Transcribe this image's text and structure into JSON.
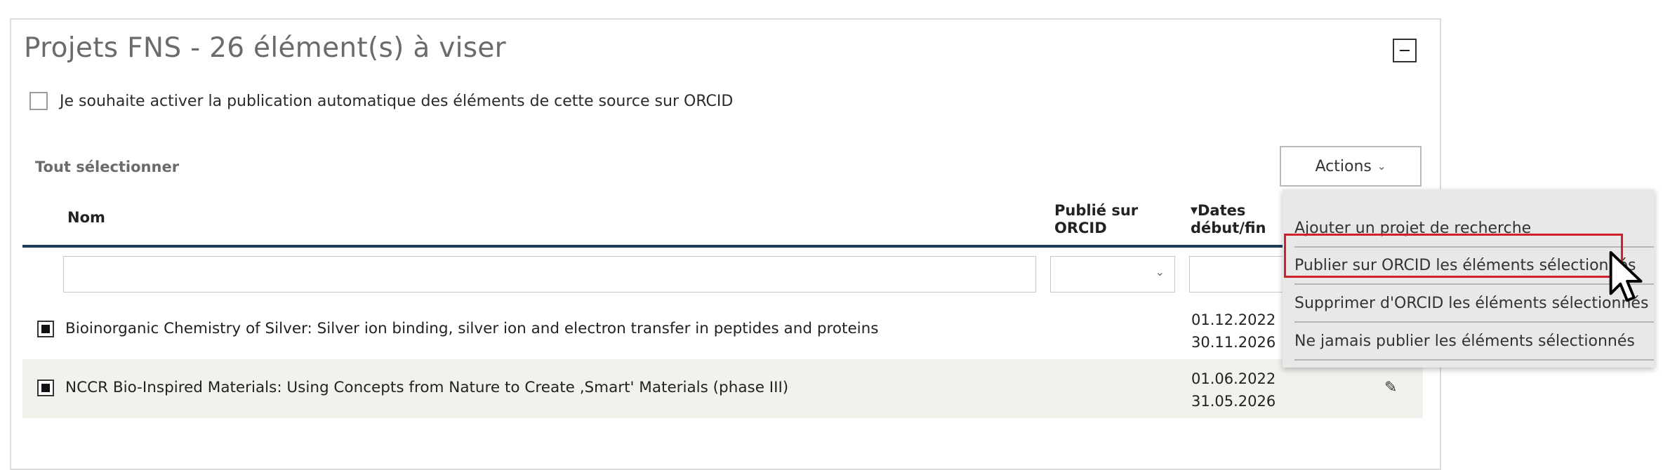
{
  "panel": {
    "title": "Projets FNS - 26 élément(s) à viser",
    "auto_publish_label": "Je souhaite activer la publication automatique des éléments de cette source sur ORCID",
    "select_all_label": "Tout sélectionner",
    "actions_label": "Actions",
    "icons": {
      "collapse": "minus-box-icon",
      "actions_chevron": "chevron-down-icon",
      "sort": "sort-desc-icon",
      "edit": "edit-icon",
      "cursor": "mouse-pointer-icon"
    }
  },
  "table": {
    "columns": {
      "nom": "Nom",
      "published": "Publié sur ORCID",
      "dates": "Dates début/fin"
    },
    "rows": [
      {
        "name": "Bioinorganic Chemistry of Silver: Silver ion binding, silver ion and electron transfer in peptides and proteins",
        "start": "01.12.2022",
        "end": "30.11.2026",
        "checked": true
      },
      {
        "name": "NCCR Bio-Inspired Materials: Using Concepts from Nature to Create ‚Smart' Materials (phase III)",
        "start": "01.06.2022",
        "end": "31.05.2026",
        "checked": true
      }
    ]
  },
  "dropdown": {
    "items": [
      "Ajouter un projet de recherche",
      "Publier sur ORCID les éléments sélectionnés",
      "Supprimer d'ORCID les éléments sélectionnés",
      "Ne jamais publier les éléments sélectionnés"
    ],
    "highlighted_index": 1,
    "highlight_color": "#d0202b"
  },
  "colors": {
    "header_rule": "#1f3c5c",
    "alt_row": "#f3f1ec",
    "dropdown_bg": "#e8e8e8"
  }
}
